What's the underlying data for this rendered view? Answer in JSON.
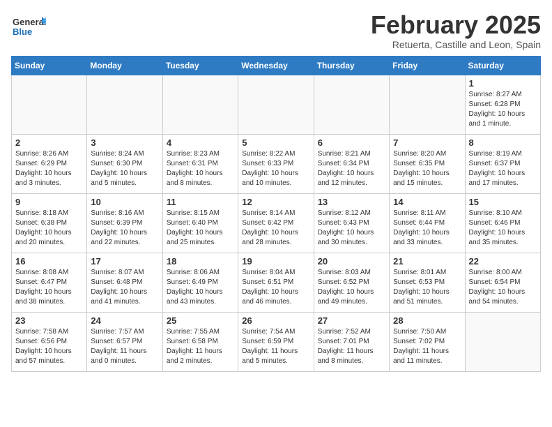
{
  "logo": {
    "general": "General",
    "blue": "Blue"
  },
  "header": {
    "month": "February 2025",
    "location": "Retuerta, Castille and Leon, Spain"
  },
  "weekdays": [
    "Sunday",
    "Monday",
    "Tuesday",
    "Wednesday",
    "Thursday",
    "Friday",
    "Saturday"
  ],
  "weeks": [
    [
      {
        "day": "",
        "info": ""
      },
      {
        "day": "",
        "info": ""
      },
      {
        "day": "",
        "info": ""
      },
      {
        "day": "",
        "info": ""
      },
      {
        "day": "",
        "info": ""
      },
      {
        "day": "",
        "info": ""
      },
      {
        "day": "1",
        "info": "Sunrise: 8:27 AM\nSunset: 6:28 PM\nDaylight: 10 hours and 1 minute."
      }
    ],
    [
      {
        "day": "2",
        "info": "Sunrise: 8:26 AM\nSunset: 6:29 PM\nDaylight: 10 hours and 3 minutes."
      },
      {
        "day": "3",
        "info": "Sunrise: 8:24 AM\nSunset: 6:30 PM\nDaylight: 10 hours and 5 minutes."
      },
      {
        "day": "4",
        "info": "Sunrise: 8:23 AM\nSunset: 6:31 PM\nDaylight: 10 hours and 8 minutes."
      },
      {
        "day": "5",
        "info": "Sunrise: 8:22 AM\nSunset: 6:33 PM\nDaylight: 10 hours and 10 minutes."
      },
      {
        "day": "6",
        "info": "Sunrise: 8:21 AM\nSunset: 6:34 PM\nDaylight: 10 hours and 12 minutes."
      },
      {
        "day": "7",
        "info": "Sunrise: 8:20 AM\nSunset: 6:35 PM\nDaylight: 10 hours and 15 minutes."
      },
      {
        "day": "8",
        "info": "Sunrise: 8:19 AM\nSunset: 6:37 PM\nDaylight: 10 hours and 17 minutes."
      }
    ],
    [
      {
        "day": "9",
        "info": "Sunrise: 8:18 AM\nSunset: 6:38 PM\nDaylight: 10 hours and 20 minutes."
      },
      {
        "day": "10",
        "info": "Sunrise: 8:16 AM\nSunset: 6:39 PM\nDaylight: 10 hours and 22 minutes."
      },
      {
        "day": "11",
        "info": "Sunrise: 8:15 AM\nSunset: 6:40 PM\nDaylight: 10 hours and 25 minutes."
      },
      {
        "day": "12",
        "info": "Sunrise: 8:14 AM\nSunset: 6:42 PM\nDaylight: 10 hours and 28 minutes."
      },
      {
        "day": "13",
        "info": "Sunrise: 8:12 AM\nSunset: 6:43 PM\nDaylight: 10 hours and 30 minutes."
      },
      {
        "day": "14",
        "info": "Sunrise: 8:11 AM\nSunset: 6:44 PM\nDaylight: 10 hours and 33 minutes."
      },
      {
        "day": "15",
        "info": "Sunrise: 8:10 AM\nSunset: 6:46 PM\nDaylight: 10 hours and 35 minutes."
      }
    ],
    [
      {
        "day": "16",
        "info": "Sunrise: 8:08 AM\nSunset: 6:47 PM\nDaylight: 10 hours and 38 minutes."
      },
      {
        "day": "17",
        "info": "Sunrise: 8:07 AM\nSunset: 6:48 PM\nDaylight: 10 hours and 41 minutes."
      },
      {
        "day": "18",
        "info": "Sunrise: 8:06 AM\nSunset: 6:49 PM\nDaylight: 10 hours and 43 minutes."
      },
      {
        "day": "19",
        "info": "Sunrise: 8:04 AM\nSunset: 6:51 PM\nDaylight: 10 hours and 46 minutes."
      },
      {
        "day": "20",
        "info": "Sunrise: 8:03 AM\nSunset: 6:52 PM\nDaylight: 10 hours and 49 minutes."
      },
      {
        "day": "21",
        "info": "Sunrise: 8:01 AM\nSunset: 6:53 PM\nDaylight: 10 hours and 51 minutes."
      },
      {
        "day": "22",
        "info": "Sunrise: 8:00 AM\nSunset: 6:54 PM\nDaylight: 10 hours and 54 minutes."
      }
    ],
    [
      {
        "day": "23",
        "info": "Sunrise: 7:58 AM\nSunset: 6:56 PM\nDaylight: 10 hours and 57 minutes."
      },
      {
        "day": "24",
        "info": "Sunrise: 7:57 AM\nSunset: 6:57 PM\nDaylight: 11 hours and 0 minutes."
      },
      {
        "day": "25",
        "info": "Sunrise: 7:55 AM\nSunset: 6:58 PM\nDaylight: 11 hours and 2 minutes."
      },
      {
        "day": "26",
        "info": "Sunrise: 7:54 AM\nSunset: 6:59 PM\nDaylight: 11 hours and 5 minutes."
      },
      {
        "day": "27",
        "info": "Sunrise: 7:52 AM\nSunset: 7:01 PM\nDaylight: 11 hours and 8 minutes."
      },
      {
        "day": "28",
        "info": "Sunrise: 7:50 AM\nSunset: 7:02 PM\nDaylight: 11 hours and 11 minutes."
      },
      {
        "day": "",
        "info": ""
      }
    ]
  ]
}
